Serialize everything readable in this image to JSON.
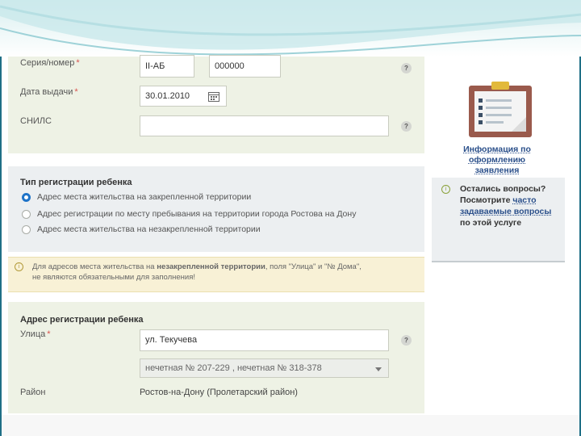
{
  "passport": {
    "series_label": "Серия/номер",
    "series_value": "II-АБ",
    "number_value": "000000",
    "issue_date_label": "Дата выдачи",
    "issue_date_value": "30.01.2010",
    "snils_label": "СНИЛС",
    "snils_value": ""
  },
  "registration_type": {
    "title": "Тип регистрации ребенка",
    "options": [
      "Адрес места жительства на закрепленной территории",
      "Адрес регистрации по месту пребывания на территории города Ростова на Дону",
      "Адрес места жительства на незакрепленной территории"
    ],
    "selected": 0
  },
  "notice": {
    "part1": "Для адресов места жительства на ",
    "bold": "незакрепленной территории",
    "part2": ", поля \"Улица\" и \"№ Дома\",",
    "line2": "не являются обязательными для заполнения!"
  },
  "address": {
    "title": "Адрес регистрации ребенка",
    "street_label": "Улица",
    "street_value": "ул. Текучева",
    "house_select": "нечетная № 207-229 , нечетная № 318-378",
    "district_label": "Район",
    "district_value": "Ростов-на-Дону (Пролетарский район)"
  },
  "sidebar": {
    "info_link": "Информация по оформлению заявления",
    "faq_line1": "Остались вопросы?",
    "faq_line2": "Посмотрите ",
    "faq_link": "часто задаваемые вопросы",
    "faq_line3": " по этой услуге"
  },
  "required_mark": "*",
  "help_glyph": "?",
  "icons": [
    "calendar-icon",
    "help-icon",
    "clipboard-icon",
    "info-icon",
    "chevron-down-icon"
  ]
}
